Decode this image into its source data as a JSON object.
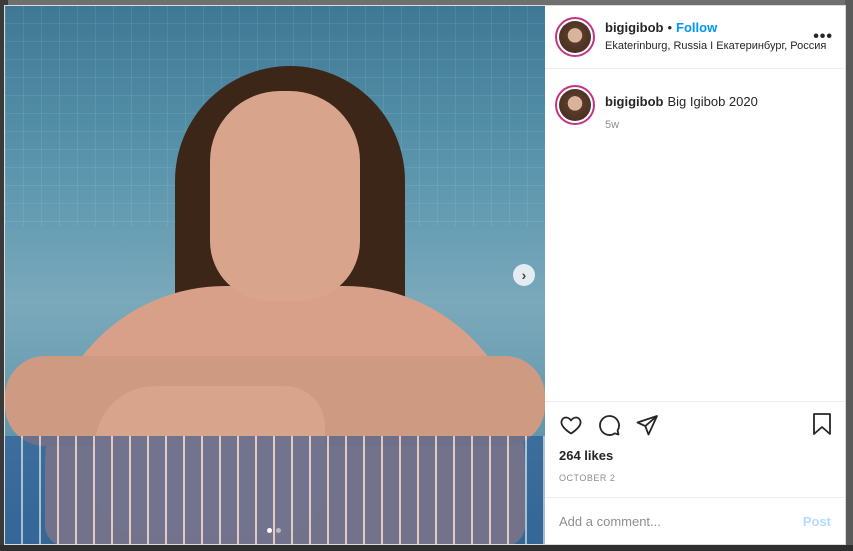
{
  "post": {
    "username": "bigigibob",
    "follow_label": "Follow",
    "separator": "•",
    "location": "Ekaterinburg, Russia I Екатеринбург, Россия",
    "more_label": "•••"
  },
  "caption": {
    "username": "bigigibob",
    "text": "Big Igibob 2020",
    "time": "5w"
  },
  "stats": {
    "likes": "264 likes",
    "date": "OCTOBER 2"
  },
  "comment": {
    "placeholder": "Add a comment...",
    "post_label": "Post"
  },
  "media": {
    "next_label": "›",
    "carousel_count": 2,
    "carousel_active": 1
  },
  "icons": {
    "like": "heart-icon",
    "comment": "comment-bubble-icon",
    "share": "paper-plane-icon",
    "save": "bookmark-icon",
    "next": "chevron-right-icon"
  },
  "colors": {
    "follow": "#0095f6",
    "post_disabled": "#b3dbff",
    "muted": "#8e8e8e",
    "avatar_ring": "#c13584"
  }
}
